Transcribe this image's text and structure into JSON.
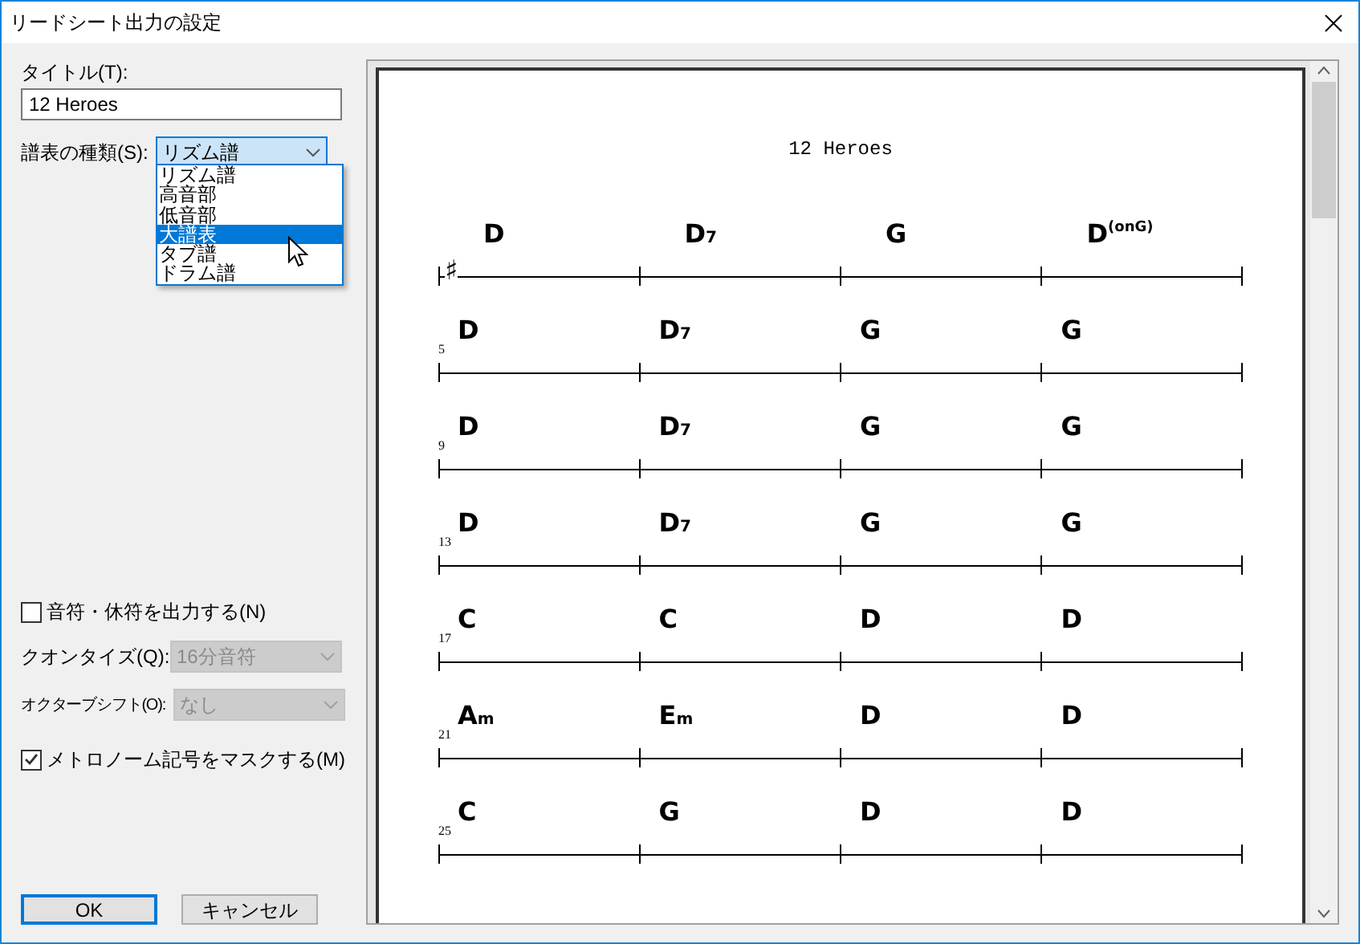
{
  "window": {
    "title": "リードシート出力の設定"
  },
  "title_field": {
    "label": "タイトル(T):",
    "value": "12 Heroes"
  },
  "staff_type": {
    "label": "譜表の種類(S):",
    "value": "リズム譜",
    "expanded": true,
    "options": [
      {
        "label": "リズム譜",
        "highlighted": false
      },
      {
        "label": "高音部",
        "highlighted": false
      },
      {
        "label": "低音部",
        "highlighted": false
      },
      {
        "label": "大譜表",
        "highlighted": true
      },
      {
        "label": "タブ譜",
        "highlighted": false
      },
      {
        "label": "ドラム譜",
        "highlighted": false
      }
    ]
  },
  "output_notes": {
    "label": "音符・休符を出力する(N)",
    "checked": false
  },
  "quantize": {
    "label": "クオンタイズ(Q):",
    "value": "16分音符",
    "disabled": true
  },
  "octave_shift": {
    "label": "オクターブシフト(O):",
    "value": "なし",
    "disabled": true
  },
  "metronome_mask": {
    "label": "メトロノーム記号をマスクする(M)",
    "checked": true
  },
  "buttons": [
    {
      "label": "OK",
      "default": true
    },
    {
      "label": "キャンセル",
      "default": false
    }
  ],
  "preview": {
    "title": "12 Heroes",
    "systems": [
      {
        "key": "♯",
        "chords": [
          {
            "root": "D"
          },
          {
            "root": "D",
            "suffix": "7"
          },
          {
            "root": "G"
          },
          {
            "root": "D",
            "upper": "(onG)"
          }
        ]
      },
      {
        "measure_number": "5",
        "chords": [
          {
            "root": "D"
          },
          {
            "root": "D",
            "suffix": "7"
          },
          {
            "root": "G"
          },
          {
            "root": "G"
          }
        ]
      },
      {
        "measure_number": "9",
        "chords": [
          {
            "root": "D"
          },
          {
            "root": "D",
            "suffix": "7"
          },
          {
            "root": "G"
          },
          {
            "root": "G"
          }
        ]
      },
      {
        "measure_number": "13",
        "chords": [
          {
            "root": "D"
          },
          {
            "root": "D",
            "suffix": "7"
          },
          {
            "root": "G"
          },
          {
            "root": "G"
          }
        ]
      },
      {
        "measure_number": "17",
        "chords": [
          {
            "root": "C"
          },
          {
            "root": "C"
          },
          {
            "root": "D"
          },
          {
            "root": "D"
          }
        ]
      },
      {
        "measure_number": "21",
        "chords": [
          {
            "root": "A",
            "suffix": "m"
          },
          {
            "root": "E",
            "suffix": "m"
          },
          {
            "root": "D"
          },
          {
            "root": "D"
          }
        ]
      },
      {
        "measure_number": "25",
        "chords": [
          {
            "root": "C"
          },
          {
            "root": "G"
          },
          {
            "root": "D"
          },
          {
            "root": "D"
          }
        ]
      }
    ]
  }
}
